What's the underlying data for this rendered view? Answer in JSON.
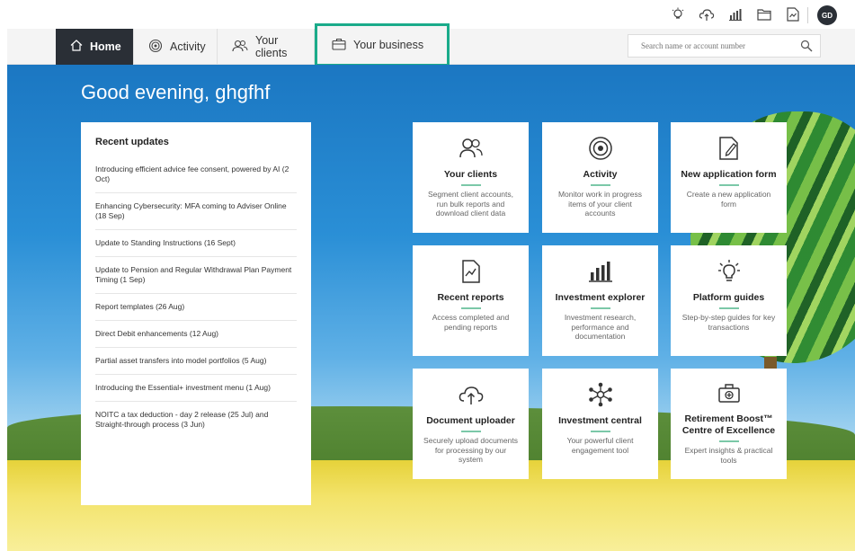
{
  "nav": {
    "tabs": [
      {
        "label": "Home",
        "icon": "home-icon"
      },
      {
        "label": "Activity",
        "icon": "activity-icon"
      },
      {
        "label": "Your clients",
        "icon": "clients-icon"
      },
      {
        "label": "Your business",
        "icon": "briefcase-icon"
      }
    ],
    "search_placeholder": "Search name or account number",
    "highlight_color": "#1aab8a"
  },
  "utility": {
    "icons": [
      "lightbulb-icon",
      "cloud-upload-icon",
      "bar-chart-icon",
      "folder-icon",
      "report-icon"
    ],
    "avatar_initials": "GD"
  },
  "greeting": "Good evening, ghgfhf",
  "updates": {
    "title": "Recent updates",
    "items": [
      "Introducing efficient advice fee consent, powered by AI (2 Oct)",
      "Enhancing Cybersecurity: MFA coming to Adviser Online (18 Sep)",
      "Update to Standing Instructions (16 Sept)",
      "Update to Pension and Regular Withdrawal Plan Payment Timing (1 Sep)",
      "Report templates (26 Aug)",
      "Direct Debit enhancements (12 Aug)",
      "Partial asset transfers into model portfolios (5 Aug)",
      "Introducing the Essential+ investment menu (1 Aug)",
      "NOITC a tax deduction - day 2 release (25 Jul) and Straight-through process (3 Jun)"
    ]
  },
  "tiles": [
    {
      "title": "Your clients",
      "desc": "Segment client accounts, run bulk reports and download client data",
      "icon": "clients-icon"
    },
    {
      "title": "Activity",
      "desc": "Monitor work in progress items of your client accounts",
      "icon": "activity-icon"
    },
    {
      "title": "New application form",
      "desc": "Create a new application form",
      "icon": "application-form-icon"
    },
    {
      "title": "Recent reports",
      "desc": "Access completed and pending reports",
      "icon": "report-icon"
    },
    {
      "title": "Investment explorer",
      "desc": "Investment research, performance and documentation",
      "icon": "bar-chart-icon"
    },
    {
      "title": "Platform guides",
      "desc": "Step-by-step guides for key transactions",
      "icon": "lightbulb-icon"
    },
    {
      "title": "Document uploader",
      "desc": "Securely upload documents for processing by our system",
      "icon": "cloud-upload-icon"
    },
    {
      "title": "Investment central",
      "desc": "Your powerful client engagement tool",
      "icon": "network-icon"
    },
    {
      "title": "Retirement Boost™ Centre of Excellence",
      "desc": "Expert insights & practical tools",
      "icon": "retirement-icon"
    }
  ]
}
